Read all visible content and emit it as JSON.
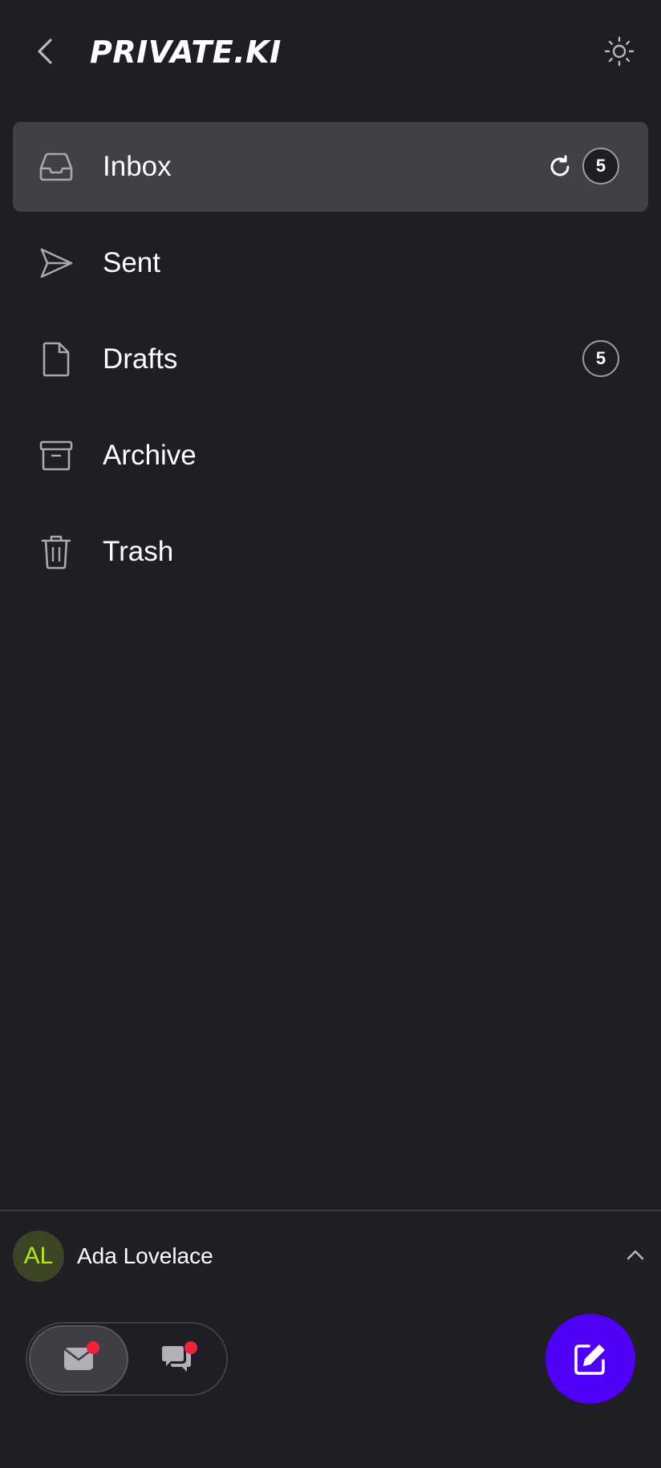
{
  "header": {
    "logo_text": "PRIVATE.KI",
    "back_icon": "chevron-left-icon",
    "theme_icon": "sun-icon"
  },
  "folders": [
    {
      "label": "Inbox",
      "icon": "inbox-icon",
      "active": true,
      "badge": "5",
      "refresh_icon": "refresh-icon"
    },
    {
      "label": "Sent",
      "icon": "send-icon",
      "active": false
    },
    {
      "label": "Drafts",
      "icon": "file-icon",
      "active": false,
      "badge": "5"
    },
    {
      "label": "Archive",
      "icon": "archive-icon",
      "active": false
    },
    {
      "label": "Trash",
      "icon": "trash-icon",
      "active": false
    }
  ],
  "account": {
    "initials": "AL",
    "name": "Ada Lovelace",
    "chevron_icon": "chevron-up-icon"
  },
  "switcher": {
    "mail_icon": "mail-icon",
    "chat_icon": "chat-icon",
    "selected": "mail"
  },
  "compose_icon": "edit-icon",
  "colors": {
    "background": "#1e1e24",
    "active_row": "#404046",
    "accent": "#5100f8",
    "notification_dot": "#f2213d",
    "avatar_bg": "#3b4424",
    "avatar_text": "#b5e61d"
  }
}
